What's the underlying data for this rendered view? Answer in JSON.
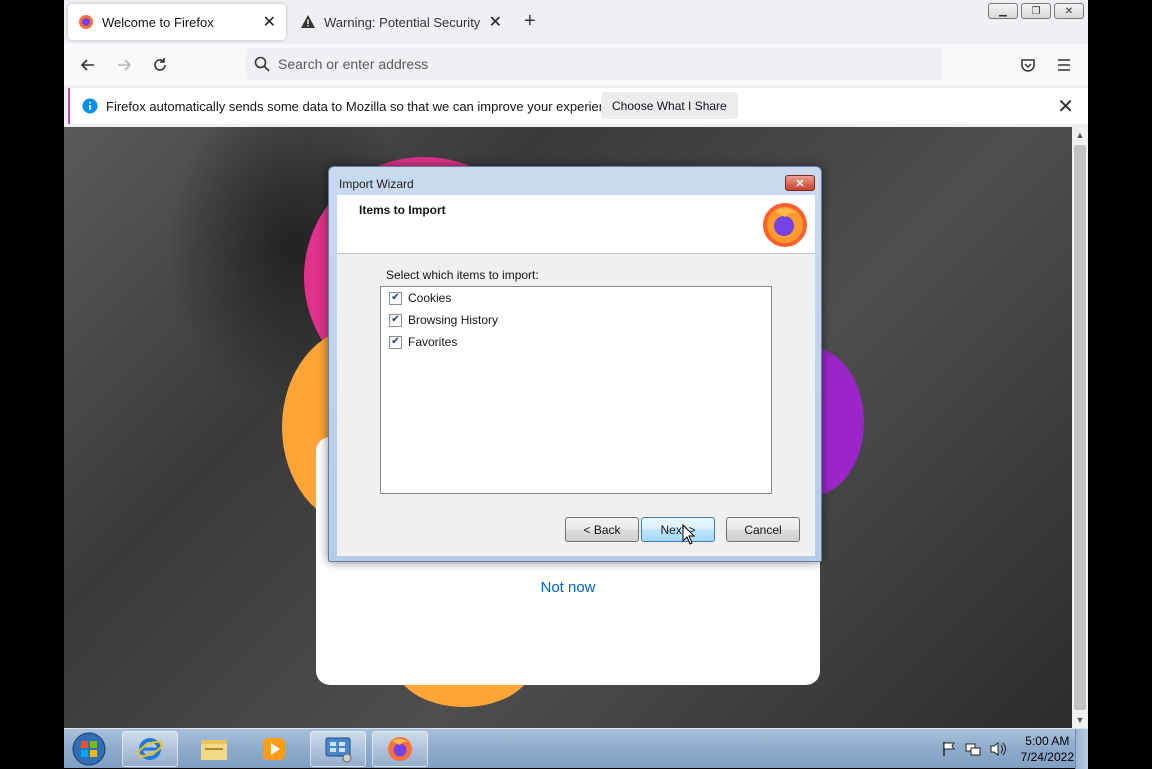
{
  "browser": {
    "tabs": [
      {
        "title": "Welcome to Firefox",
        "active": true
      },
      {
        "title": "Warning: Potential Security Risk",
        "active": false
      }
    ],
    "address_placeholder": "Search or enter address",
    "notification": {
      "message": "Firefox automatically sends some data to Mozilla so that we can improve your experience.",
      "button": "Choose What I Share"
    }
  },
  "page": {
    "not_now": "Not now"
  },
  "dialog": {
    "title": "Import Wizard",
    "header": "Items to Import",
    "instruction": "Select which items to import:",
    "items": [
      {
        "label": "Cookies",
        "checked": true
      },
      {
        "label": "Browsing History",
        "checked": true
      },
      {
        "label": "Favorites",
        "checked": true
      }
    ],
    "buttons": {
      "back": "< Back",
      "next": "Next >",
      "cancel": "Cancel"
    }
  },
  "taskbar": {
    "time": "5:00 AM",
    "date": "7/24/2022"
  },
  "colors": {
    "accent": "#0060df",
    "notification_bar": "#c34bb4",
    "blob_pink": "#e0328a",
    "blob_orange": "#ffa436",
    "blob_purple": "#9b25c9"
  }
}
